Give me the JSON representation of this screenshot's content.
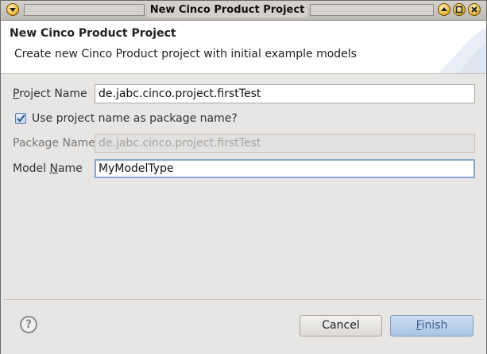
{
  "window": {
    "title": "New Cinco Product Project",
    "controls": [
      "menu-icon",
      "minimize-icon",
      "maximize-icon",
      "close-icon"
    ]
  },
  "header": {
    "title": "New Cinco Product Project",
    "description": "Create new Cinco Product project with initial example models"
  },
  "form": {
    "project_name": {
      "label_mnemonic": "P",
      "label_rest": "roject Name",
      "value": "de.jabc.cinco.project.firstTest"
    },
    "use_project_name": {
      "label": "Use project name as package name?",
      "checked": true
    },
    "package_name": {
      "label": "Package Name",
      "value": "de.jabc.cinco.project.firstTest",
      "enabled": false
    },
    "model_name": {
      "label_prefix": "Model ",
      "label_mnemonic": "N",
      "label_rest": "ame",
      "value": "MyModelType"
    }
  },
  "footer": {
    "help_label": "?",
    "cancel_label": "Cancel",
    "finish_mnemonic": "F",
    "finish_rest": "inish"
  },
  "colors": {
    "accent": "#86a8cf",
    "title_button": "#f0c24a"
  }
}
